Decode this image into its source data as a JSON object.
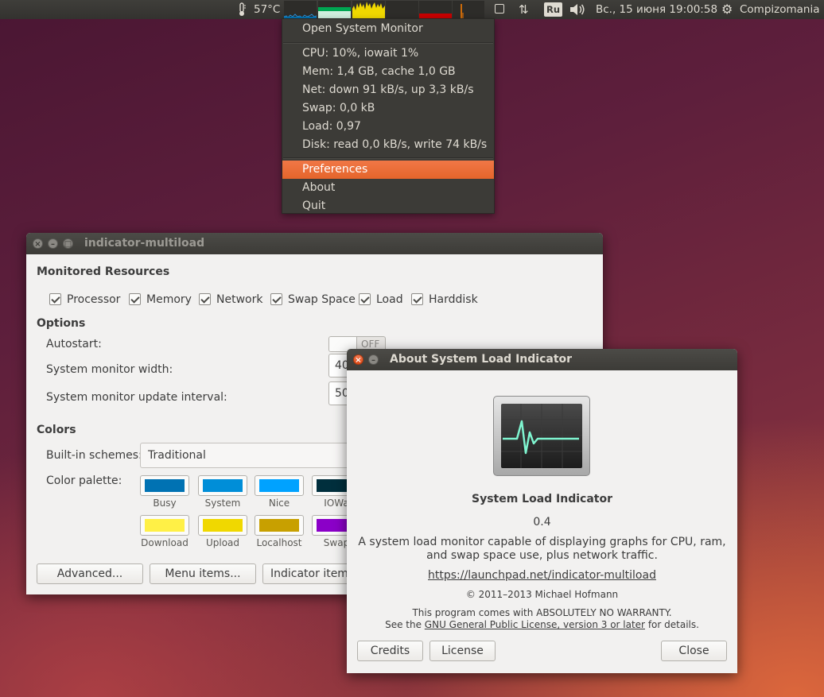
{
  "panel": {
    "temperature": "57°C",
    "keyboard_layout": "Ru",
    "clock": "Вс., 15 июня 19:00:58",
    "user": "Compizomania",
    "icons": [
      "thermometer-icon",
      "load-graphs",
      "checkbox-icon",
      "network-arrows-icon",
      "volume-icon",
      "gear-icon"
    ],
    "graph_colors": {
      "cpu": "#0072b3",
      "mem": "#00a652",
      "net": "#f0d800",
      "swap": "#8b00ff",
      "load": "#c80000",
      "disk": "#ff7f00"
    }
  },
  "menu": {
    "open_monitor": "Open System Monitor",
    "stats": [
      "CPU: 10%, iowait 1%",
      "Mem: 1,4 GB, cache 1,0 GB",
      "Net: down 91 kB/s, up 3,3 kB/s",
      "Swap: 0,0 kB",
      "Load: 0,97",
      "Disk: read 0,0 kB/s, write 74 kB/s"
    ],
    "preferences": "Preferences",
    "about": "About",
    "quit": "Quit",
    "highlight_color": "#e95420"
  },
  "prefs": {
    "title": "indicator-multiload",
    "monitored_heading": "Monitored Resources",
    "resources": [
      "Processor",
      "Memory",
      "Network",
      "Swap Space",
      "Load",
      "Harddisk"
    ],
    "options_heading": "Options",
    "autostart_label": "Autostart:",
    "autostart_state": "OFF",
    "width_label": "System monitor width:",
    "width_value": "40",
    "interval_label": "System monitor update interval:",
    "interval_value": "50",
    "colors_heading": "Colors",
    "schemes_label": "Built-in schemes:",
    "scheme_value": "Traditional",
    "palette_label": "Color palette:",
    "palette": [
      {
        "name": "Busy",
        "color": "#0072b3"
      },
      {
        "name": "System",
        "color": "#008ed8"
      },
      {
        "name": "Nice",
        "color": "#00a2ff"
      },
      {
        "name": "IOWa",
        "color": "#002f3d"
      },
      {
        "name": "Download",
        "color": "#fff046"
      },
      {
        "name": "Upload",
        "color": "#f0d800"
      },
      {
        "name": "Localhost",
        "color": "#c8a000"
      },
      {
        "name": "Swap",
        "color": "#8b00c8"
      }
    ],
    "advanced_button": "Advanced...",
    "menu_items_button": "Menu items...",
    "indicator_items_button": "Indicator items..."
  },
  "about": {
    "title": "About System Load Indicator",
    "app_name": "System Load Indicator",
    "version": "0.4",
    "description_1": "A system load monitor capable of displaying graphs for CPU, ram,",
    "description_2": "and swap space use, plus network traffic.",
    "website": "https://launchpad.net/indicator-multiload",
    "copyright": "© 2011–2013 Michael Hofmann",
    "warranty_1": "This program comes with ABSOLUTELY NO WARRANTY.",
    "warranty_pre": "See the ",
    "license_link": "GNU General Public License, version 3 or later",
    "warranty_post": " for details.",
    "credits_button": "Credits",
    "license_button": "License",
    "close_button": "Close"
  }
}
